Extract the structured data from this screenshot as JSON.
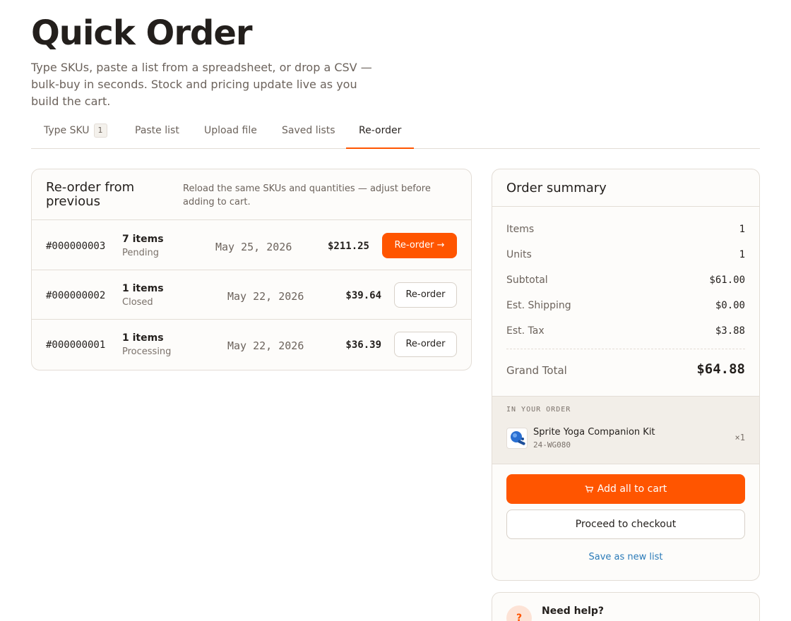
{
  "page": {
    "title": "Quick Order",
    "subtitle": "Type SKUs, paste a list from a spreadsheet, or drop a CSV — bulk-buy in seconds. Stock and pricing update live as you build the cart."
  },
  "tabs": [
    {
      "label": "Type SKU",
      "badge": "1"
    },
    {
      "label": "Paste list"
    },
    {
      "label": "Upload file"
    },
    {
      "label": "Saved lists"
    },
    {
      "label": "Re-order",
      "active": true
    }
  ],
  "reorder": {
    "title": "Re-order from previous",
    "description": "Reload the same SKUs and quantities — adjust before adding to cart.",
    "orders": [
      {
        "id": "#000000003",
        "items": "7 items",
        "status": "Pending",
        "date": "May 25, 2026",
        "total": "$211.25",
        "button": "Re-order →",
        "primary": true
      },
      {
        "id": "#000000002",
        "items": "1 items",
        "status": "Closed",
        "date": "May 22, 2026",
        "total": "$39.64",
        "button": "Re-order",
        "primary": false
      },
      {
        "id": "#000000001",
        "items": "1 items",
        "status": "Processing",
        "date": "May 22, 2026",
        "total": "$36.39",
        "button": "Re-order",
        "primary": false
      }
    ]
  },
  "summary": {
    "title": "Order summary",
    "rows": [
      {
        "label": "Items",
        "value": "1"
      },
      {
        "label": "Units",
        "value": "1"
      },
      {
        "label": "Subtotal",
        "value": "$61.00"
      },
      {
        "label": "Est. Shipping",
        "value": "$0.00"
      },
      {
        "label": "Est. Tax",
        "value": "$3.88"
      }
    ],
    "grand_total_label": "Grand Total",
    "grand_total_value": "$64.88",
    "in_order_label": "IN YOUR ORDER",
    "product": {
      "name": "Sprite Yoga Companion Kit",
      "sku": "24-WG080",
      "qty": "×1",
      "icon": "yoga-kit-thumbnail"
    },
    "add_all_label": "Add all to cart",
    "checkout_label": "Proceed to checkout",
    "save_list_label": "Save as new list"
  },
  "help": {
    "icon": "?",
    "title": "Need help?"
  },
  "colors": {
    "accent": "#ff5500",
    "link": "#2a7ab8"
  }
}
